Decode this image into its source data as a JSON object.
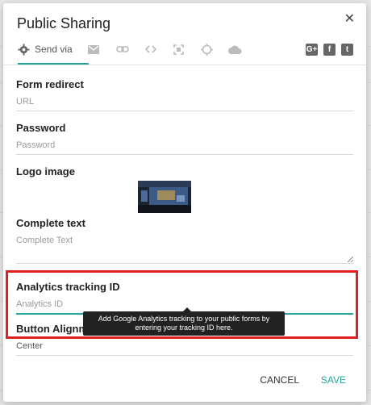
{
  "dialog": {
    "title": "Public Sharing",
    "close_glyph": "✕"
  },
  "tabs": {
    "active_label": "Send via",
    "items": [
      "gear-icon",
      "mail-icon",
      "link-icon",
      "code-icon",
      "embed-icon",
      "target-icon",
      "cloud-icon"
    ],
    "social": [
      {
        "name": "google-plus-icon",
        "glyph": "G+"
      },
      {
        "name": "facebook-icon",
        "glyph": "f"
      },
      {
        "name": "twitter-icon",
        "glyph": "t"
      }
    ]
  },
  "fields": {
    "form_redirect": {
      "label": "Form redirect",
      "placeholder": "URL"
    },
    "password": {
      "label": "Password",
      "placeholder": "Password"
    },
    "logo": {
      "label": "Logo image"
    },
    "complete_text": {
      "label": "Complete text",
      "placeholder": "Complete Text"
    },
    "analytics": {
      "label": "Analytics tracking ID",
      "placeholder": "Analytics ID"
    },
    "button_alignment": {
      "label": "Button Alignme",
      "value": "Center"
    }
  },
  "tooltip": {
    "line1": "Add Google Analytics tracking to your public forms by",
    "line2": "entering your tracking ID here."
  },
  "footer": {
    "cancel": "CANCEL",
    "save": "SAVE"
  },
  "colors": {
    "accent": "#26a69a",
    "highlight": "#e02020"
  }
}
